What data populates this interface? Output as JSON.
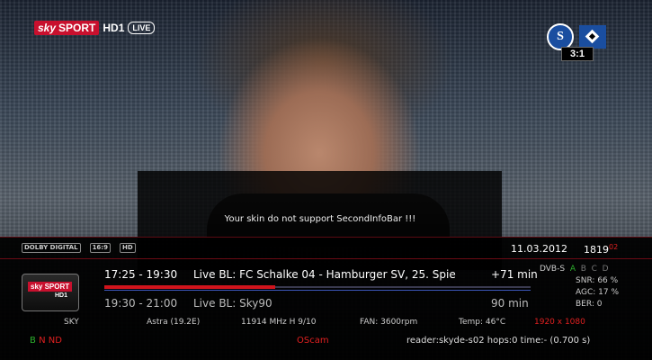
{
  "channel": {
    "sky_label": "sky",
    "sport_label": "SPORT",
    "hd_label": "HD1",
    "live_label": "LIVE"
  },
  "score": {
    "home_label": "S",
    "value": "3:1"
  },
  "message": "Your skin do not support SecondInfoBar !!!",
  "infobar": {
    "icons": [
      "DOLBY DIGITAL",
      "16:9",
      "HD"
    ],
    "date": "11.03.2012",
    "time": "1819",
    "seconds": "02",
    "picon": {
      "sky": "sky SPORT",
      "hd": "HD1"
    },
    "now": {
      "time": "17:25 - 19:30",
      "title": "Live BL: FC Schalke 04 - Hamburger SV, 25. Spie",
      "remaining": "+71 min",
      "progress": 0.4
    },
    "next": {
      "time": "19:30 - 21:00",
      "title": "Live BL: Sky90",
      "duration": "90 min"
    },
    "signal": {
      "dvb": "DVB-S",
      "a": "A",
      "b": "B",
      "c": "C",
      "d": "D",
      "snr": "SNR: 66 %",
      "agc": "AGC: 17 %",
      "ber": "BER:  0"
    },
    "tech": {
      "provider": "SKY",
      "satellite": "Astra (19.2E)",
      "frequency": "11914 MHz H 9/10",
      "fan": "FAN:  3600rpm",
      "temp": "Temp: 46°C",
      "resolution": "1920 x 1080"
    },
    "bottom": {
      "cas_b": "B",
      "cas_n": "N",
      "cas_nd": "ND",
      "cam": "OScam",
      "reader": "reader:skyde-s02 hops:0 time:- (0.700 s)"
    }
  },
  "colors": {
    "accent": "#d0141c",
    "green": "#2db02d",
    "blue_line": "#3b55b8"
  }
}
